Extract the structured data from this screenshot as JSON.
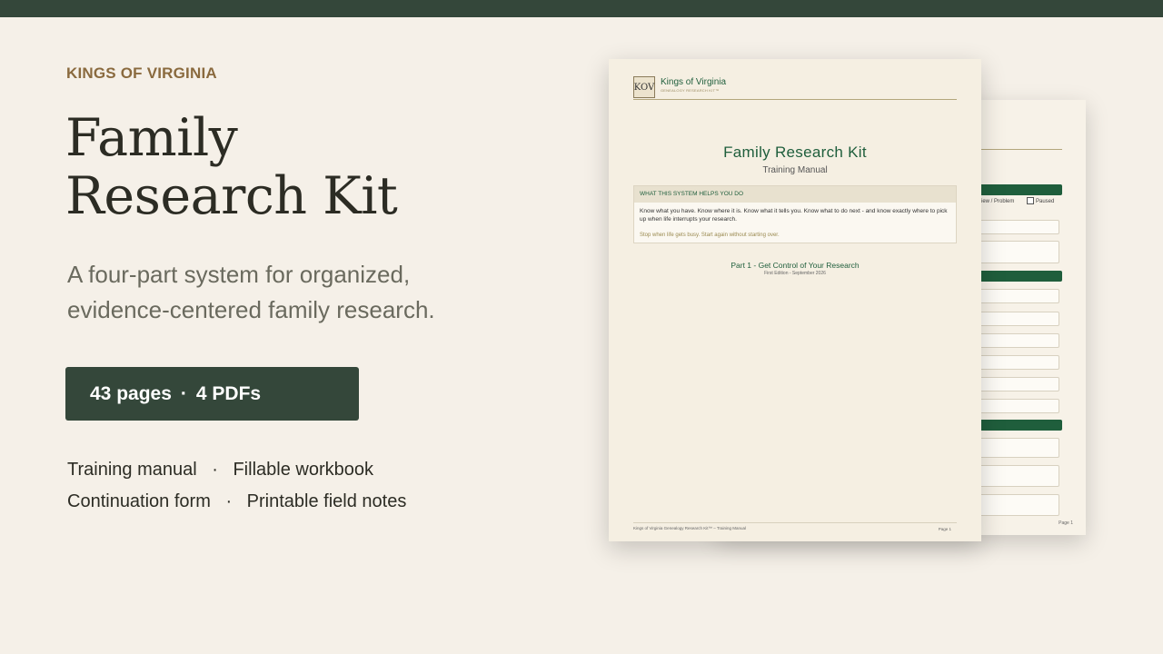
{
  "brand": "KINGS OF VIRGINIA",
  "title_lines": [
    "Family",
    "Research Kit"
  ],
  "subtitle_lines": [
    "A four-part system for organized,",
    "evidence-centered family research."
  ],
  "badge": {
    "pages": "43 pages",
    "separator": "·",
    "pdfs": "4 PDFs"
  },
  "features": [
    [
      "Training manual",
      "Fillable workbook"
    ],
    [
      "Continuation form",
      "Printable field notes"
    ]
  ],
  "feature_separator": "·",
  "colors": {
    "dark_green": "#34473a",
    "accent_brown": "#8a6a3e",
    "background": "#f5f0e8",
    "doc_green": "#1f5e3c"
  },
  "preview_front": {
    "logo": "KOV",
    "brand": "Kings of Virginia",
    "tagline": "GENEALOGY RESEARCH KIT™",
    "title": "Family Research Kit",
    "subtitle": "Training Manual",
    "box_heading": "WHAT THIS SYSTEM HELPS YOU DO",
    "box_text": "Know what you have. Know where it is. Know what it tells you. Know what to do next - and know exactly where to pick up when life interrupts your research.",
    "box_note": "Stop when life gets busy. Start again without starting over.",
    "part_title": "Part 1 - Get Control of Your Research",
    "edition": "First Edition - September 2026",
    "footer_left": "Kings of Virginia Genealogy Research Kit™ – Training Manual",
    "footer_right": "Page 1"
  },
  "preview_back": {
    "label_review": "iew / Problem",
    "label_paused": "Paused",
    "page_number": "Page 1"
  }
}
